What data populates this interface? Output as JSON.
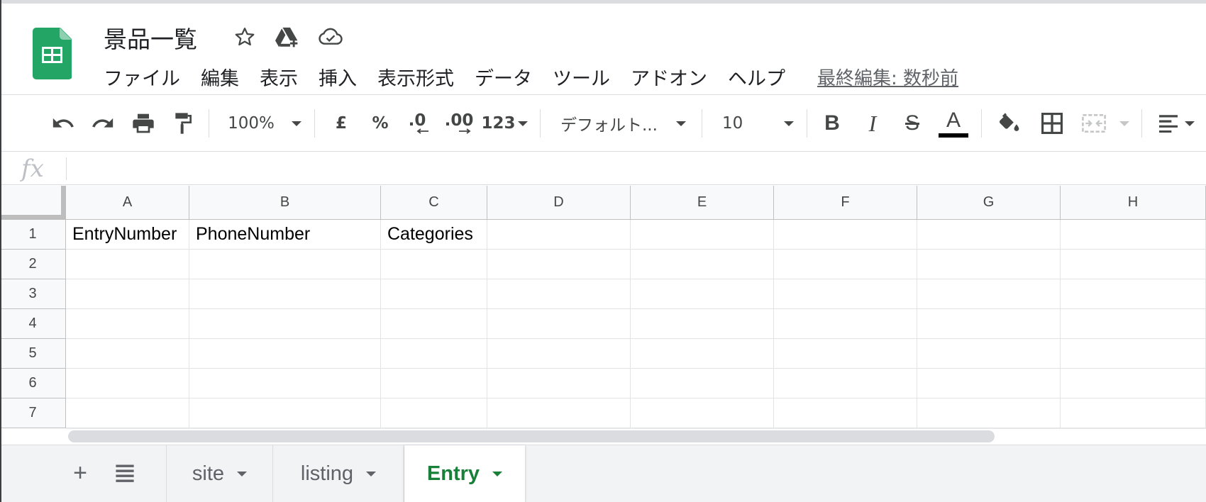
{
  "document": {
    "title": "景品一覧",
    "last_edit": "最終編集: 数秒前"
  },
  "menu": {
    "items": [
      {
        "label": "ファイル"
      },
      {
        "label": "編集"
      },
      {
        "label": "表示"
      },
      {
        "label": "挿入"
      },
      {
        "label": "表示形式"
      },
      {
        "label": "データ"
      },
      {
        "label": "ツール"
      },
      {
        "label": "アドオン"
      },
      {
        "label": "ヘルプ"
      }
    ]
  },
  "toolbar": {
    "zoom": "100%",
    "currency": "£",
    "percent": "%",
    "decrease_decimal": ".0",
    "increase_decimal": ".00",
    "more_formats": "123",
    "font": "デフォルト...",
    "font_size": "10",
    "bold": "B",
    "italic": "I",
    "strikethrough": "S",
    "text_color_letter": "A",
    "text_color": "#000000"
  },
  "formula_bar": {
    "fx_label": "fx",
    "value": ""
  },
  "grid": {
    "columns": [
      "A",
      "B",
      "C",
      "D",
      "E",
      "F",
      "G",
      "H"
    ],
    "rows": [
      "1",
      "2",
      "3",
      "4",
      "5",
      "6",
      "7"
    ],
    "cells": {
      "A1": "EntryNumber",
      "B1": "PhoneNumber",
      "C1": "Categories"
    }
  },
  "sheets": {
    "add_label": "+",
    "tabs": [
      {
        "label": "site",
        "active": false
      },
      {
        "label": "listing",
        "active": false
      },
      {
        "label": "Entry",
        "active": true
      }
    ],
    "active_color": "#188038"
  },
  "colors": {
    "brand_green": "#0f9d58",
    "header_bg": "#f8f9fa",
    "sheet_bar_bg": "#f1f3f4"
  }
}
